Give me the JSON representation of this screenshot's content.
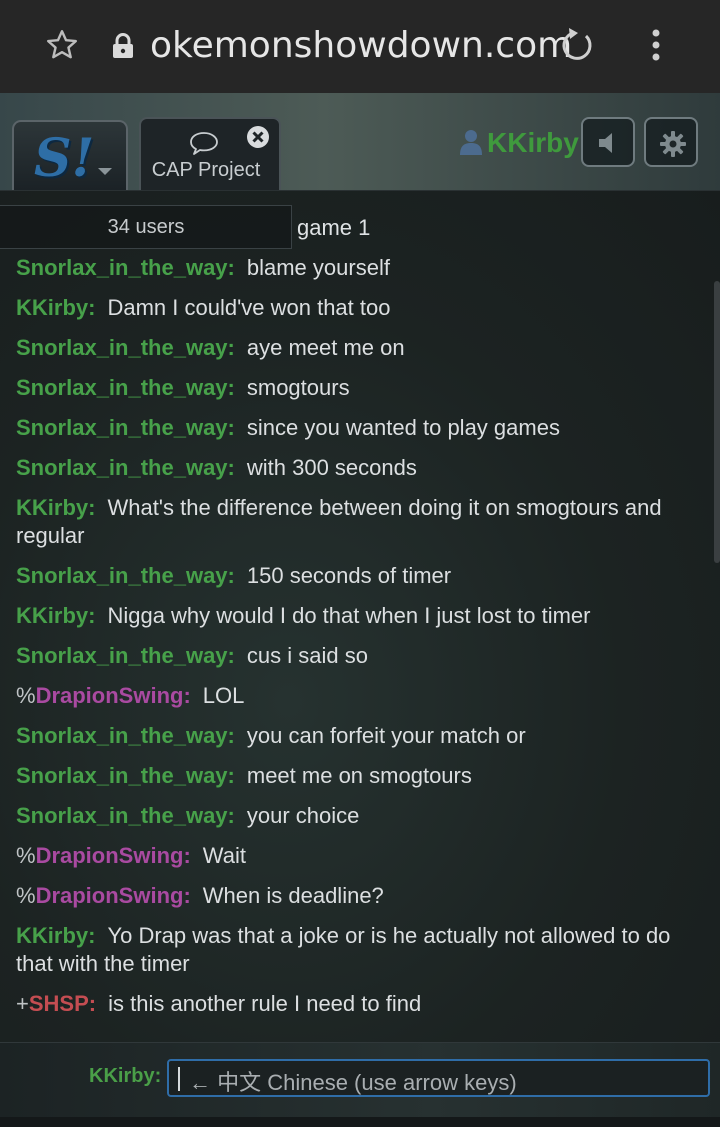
{
  "browser": {
    "url": "okemonshowdown.com"
  },
  "header": {
    "room_tab_label": "CAP Project",
    "username": "KKirby"
  },
  "chat": {
    "userlist_label": "34 users",
    "partial_first_line": "game 1",
    "messages": [
      {
        "rank": "",
        "name": "Snorlax_in_the_way:",
        "text": "blame yourself",
        "color": "#47a14a"
      },
      {
        "rank": "",
        "name": "KKirby:",
        "text": "Damn I could've won that too",
        "color": "#47a14a"
      },
      {
        "rank": "",
        "name": "Snorlax_in_the_way:",
        "text": "aye meet me on",
        "color": "#47a14a"
      },
      {
        "rank": "",
        "name": "Snorlax_in_the_way:",
        "text": "smogtours",
        "color": "#47a14a"
      },
      {
        "rank": "",
        "name": "Snorlax_in_the_way:",
        "text": "since you wanted to play games",
        "color": "#47a14a"
      },
      {
        "rank": "",
        "name": "Snorlax_in_the_way:",
        "text": "with 300 seconds",
        "color": "#47a14a"
      },
      {
        "rank": "",
        "name": "KKirby:",
        "text": "What's the difference between doing it on smogtours and regular",
        "color": "#47a14a"
      },
      {
        "rank": "",
        "name": "Snorlax_in_the_way:",
        "text": "150 seconds of timer",
        "color": "#47a14a"
      },
      {
        "rank": "",
        "name": "KKirby:",
        "text": "Nigga why would I do that when I just lost to timer",
        "color": "#47a14a"
      },
      {
        "rank": "",
        "name": "Snorlax_in_the_way:",
        "text": "cus i said so",
        "color": "#47a14a"
      },
      {
        "rank": "%",
        "name": "DrapionSwing:",
        "text": "LOL",
        "color": "#a94aa1"
      },
      {
        "rank": "",
        "name": "Snorlax_in_the_way:",
        "text": "you can forfeit your match or",
        "color": "#47a14a"
      },
      {
        "rank": "",
        "name": "Snorlax_in_the_way:",
        "text": "meet me on smogtours",
        "color": "#47a14a"
      },
      {
        "rank": "",
        "name": "Snorlax_in_the_way:",
        "text": "your choice",
        "color": "#47a14a"
      },
      {
        "rank": "%",
        "name": "DrapionSwing:",
        "text": "Wait",
        "color": "#a94aa1"
      },
      {
        "rank": "%",
        "name": "DrapionSwing:",
        "text": "When is deadline?",
        "color": "#a94aa1"
      },
      {
        "rank": "",
        "name": "KKirby:",
        "text": "Yo Drap was that a joke or is he actually not allowed to do that with the timer",
        "color": "#47a14a"
      },
      {
        "rank": "+",
        "name": "SHSP:",
        "text": "is this another rule I need to find",
        "color": "#c44d52"
      }
    ]
  },
  "composer": {
    "name_label": "KKirby:",
    "placeholder": "← 中文 Chinese (use arrow keys)"
  },
  "icons": {
    "star": "star-outline-icon",
    "lock": "lock-icon",
    "reload": "reload-icon",
    "menu": "more-vert-icon",
    "chat_bubble": "chat-bubble-icon",
    "close": "close-circle-icon",
    "user": "user-icon",
    "sound": "sound-muted-icon",
    "gear": "gear-icon"
  }
}
